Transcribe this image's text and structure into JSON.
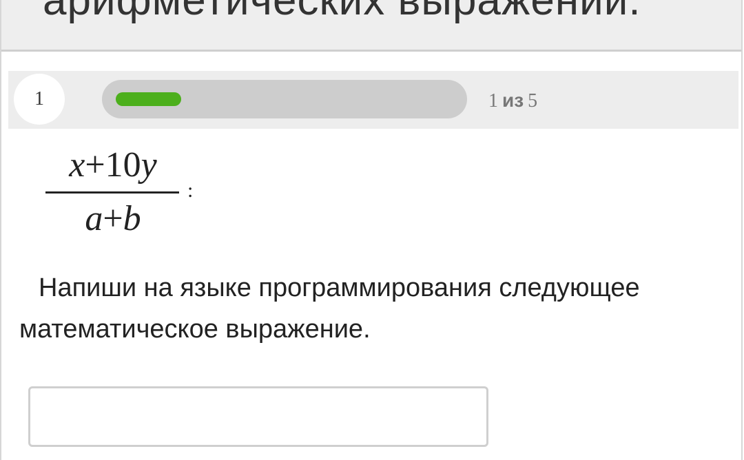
{
  "header": {
    "title": "арифметических выражений."
  },
  "progress": {
    "step_number": "1",
    "current": "1",
    "of_label": "из",
    "total": "5",
    "fraction": 0.2,
    "bar_color": "#4caf1c"
  },
  "formula": {
    "numerator": {
      "x": "x",
      "plus": "+",
      "number": "10",
      "y": "y"
    },
    "denominator": {
      "a": "a",
      "plus": "+",
      "b": "b"
    },
    "trailing": ":"
  },
  "task": {
    "instruction": "Напиши на языке программирования следующее математическое выражение."
  },
  "answer": {
    "value": "",
    "placeholder": ""
  }
}
